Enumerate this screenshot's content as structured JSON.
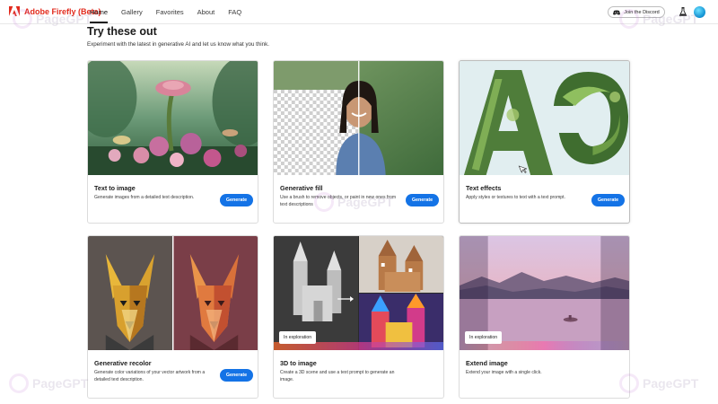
{
  "app": {
    "brand": "Adobe Firefly (Beta)"
  },
  "nav": {
    "items": [
      {
        "label": "Home"
      },
      {
        "label": "Gallery"
      },
      {
        "label": "Favorites"
      },
      {
        "label": "About"
      },
      {
        "label": "FAQ"
      }
    ],
    "active": "Home"
  },
  "header_actions": {
    "discord_label": "Join the Discord",
    "icons": [
      "discord-icon",
      "flask-icon",
      "avatar"
    ]
  },
  "page": {
    "title": "Try these out",
    "subtitle": "Experiment with the latest in generative AI and let us know what you think."
  },
  "cards": [
    {
      "title": "Text to image",
      "description": "Generate images from a detailed text description.",
      "button": "Generate"
    },
    {
      "title": "Generative fill",
      "description": "Use a brush to remove objects, or paint in new ones from text descriptions",
      "button": "Generate"
    },
    {
      "title": "Text effects",
      "description": "Apply styles or textures to text with a text prompt.",
      "button": "Generate"
    },
    {
      "title": "Generative recolor",
      "description": "Generate color variations of your vector artwork from a detailed text description.",
      "button": "Generate"
    },
    {
      "title": "3D to image",
      "description": "Create a 3D scene and use a text prompt to generate an image.",
      "badge": "In exploration"
    },
    {
      "title": "Extend image",
      "description": "Extend your image with a single click.",
      "badge": "In exploration"
    }
  ],
  "watermark": {
    "text": "PageGPT"
  },
  "colors": {
    "brand_red": "#e22a1d",
    "accent_blue": "#1473e6"
  }
}
